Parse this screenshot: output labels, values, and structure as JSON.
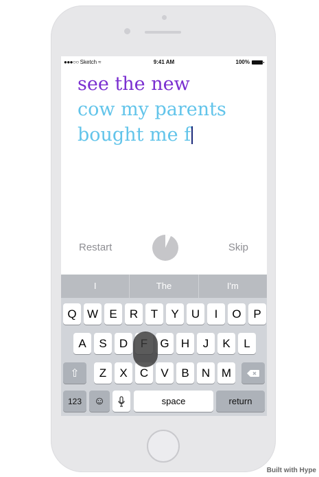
{
  "status_bar": {
    "carrier": "Sketch",
    "time": "9:41 AM",
    "battery": "100%"
  },
  "prompt": {
    "typed": "see the new",
    "remaining_line1": "cow my parents",
    "remaining_line2": "bought me f"
  },
  "controls": {
    "restart_label": "Restart",
    "skip_label": "Skip",
    "timer_progress": 0.07
  },
  "keyboard": {
    "suggestions": [
      "I",
      "The",
      "I'm"
    ],
    "row1": [
      "Q",
      "W",
      "E",
      "R",
      "T",
      "Y",
      "U",
      "I",
      "O",
      "P"
    ],
    "row2": [
      "A",
      "S",
      "D",
      "F",
      "G",
      "H",
      "J",
      "K",
      "L"
    ],
    "row3": [
      "Z",
      "X",
      "C",
      "V",
      "B",
      "N",
      "M"
    ],
    "numbers_label": "123",
    "space_label": "space",
    "return_label": "return"
  },
  "footer": {
    "built_with": "Built with Hype"
  },
  "colors": {
    "typed_text": "#7a2fd0",
    "remaining_text": "#62c4ea"
  }
}
